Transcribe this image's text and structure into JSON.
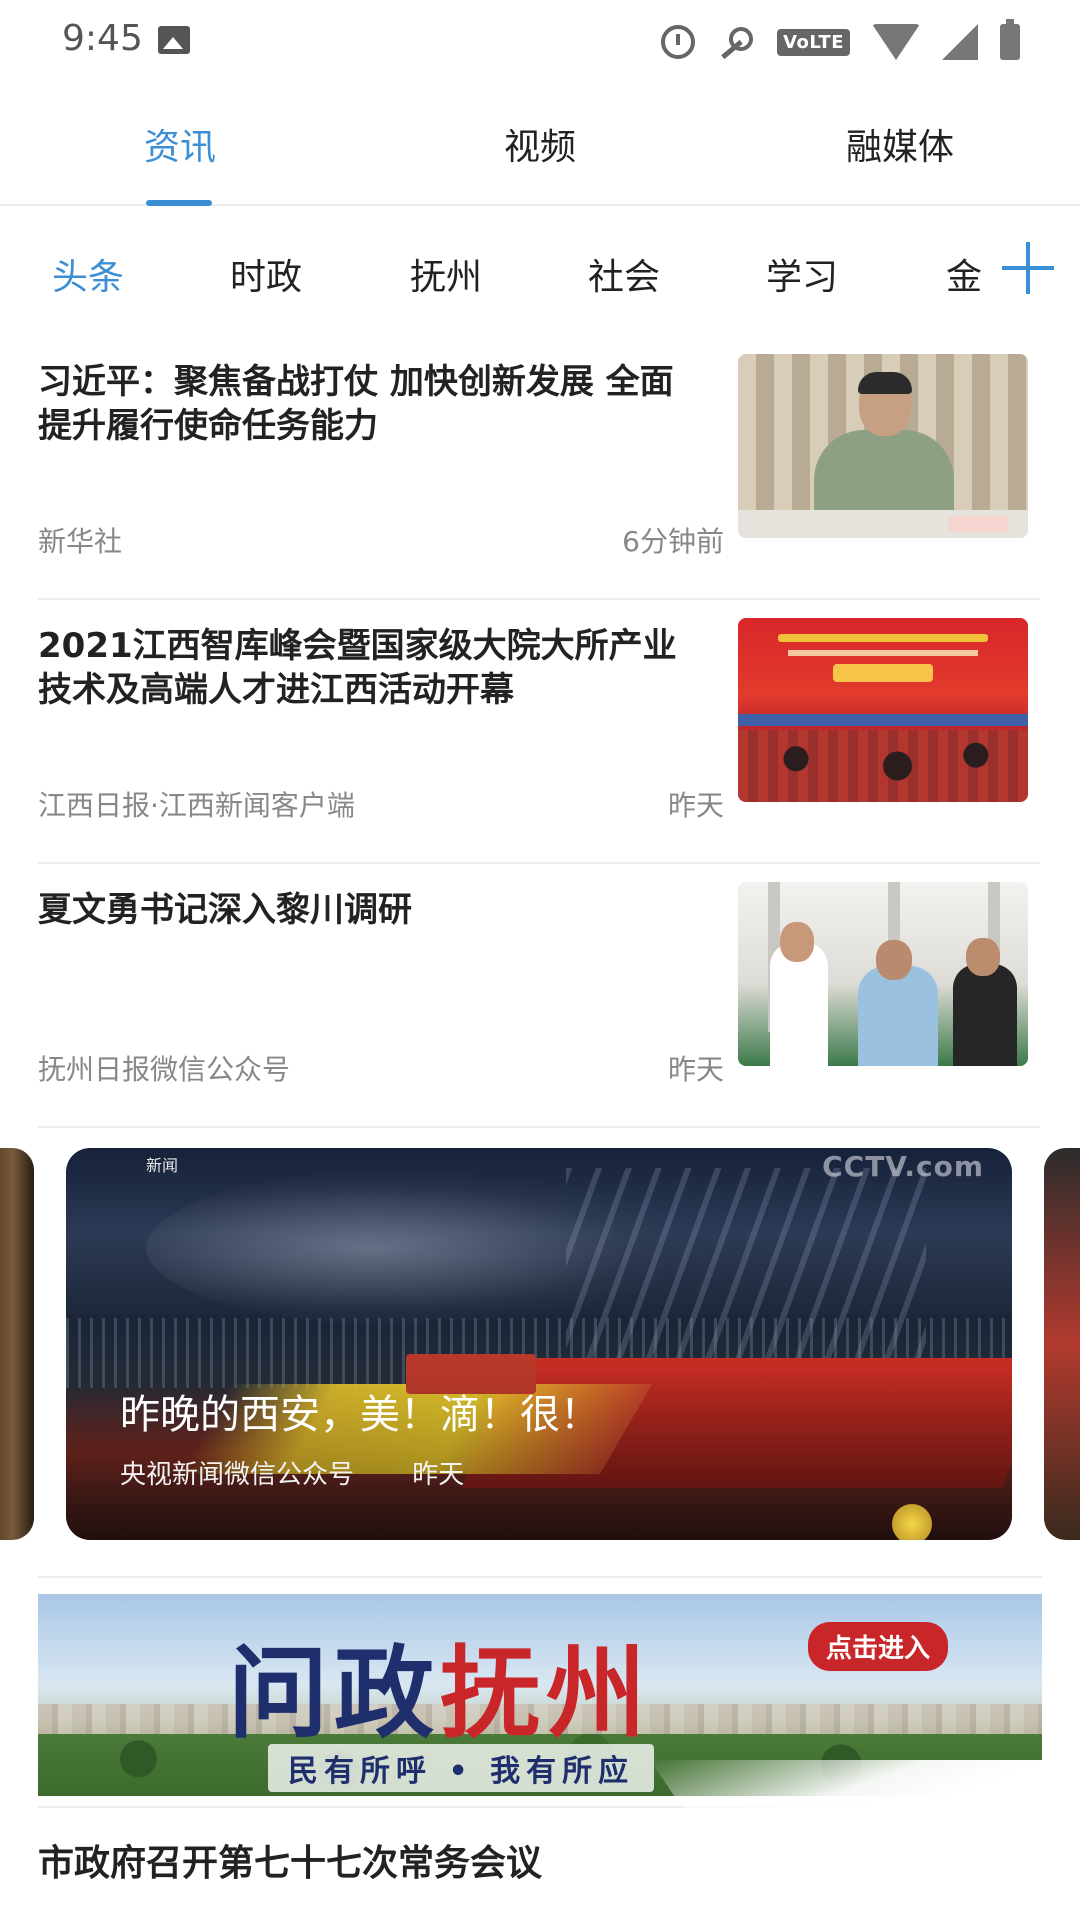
{
  "status_bar": {
    "time": "9:45",
    "volte": "VoLTE",
    "icons": [
      "image-icon",
      "alarm-icon",
      "vpn-key-icon",
      "volte-icon",
      "wifi-icon",
      "signal-icon",
      "battery-icon"
    ]
  },
  "main_tabs": [
    "资讯",
    "视频",
    "融媒体"
  ],
  "main_tab_active_index": 0,
  "category_tabs": [
    "头条",
    "时政",
    "抚州",
    "社会",
    "学习",
    "金"
  ],
  "category_tab_active_index": 0,
  "news": [
    {
      "title": "习近平：聚焦备战打仗 加快创新发展 全面提升履行使命任务能力",
      "source": "新华社",
      "time": "6分钟前"
    },
    {
      "title": "2021江西智库峰会暨国家级大院大所产业技术及高端人才进江西活动开幕",
      "source": "江西日报·江西新闻客户端",
      "time": "昨天"
    },
    {
      "title": "夏文勇书记深入黎川调研",
      "source": "抚州日报微信公众号",
      "time": "昨天"
    }
  ],
  "carousel": {
    "title": "昨晚的西安，美！滴！很！",
    "source": "央视新闻微信公众号",
    "time": "昨天",
    "corner_text": "新闻",
    "logo_text": "CCTV.com"
  },
  "banner": {
    "title_part1": "问政",
    "title_part2": "抚州",
    "button_label": "点击进入",
    "slogan": "民有所呼 • 我有所应"
  },
  "bottom_item": {
    "title": "市政府召开第七十七次常务会议"
  },
  "colors": {
    "accent": "#3a8fd6",
    "text": "#222222",
    "meta": "#888888"
  }
}
